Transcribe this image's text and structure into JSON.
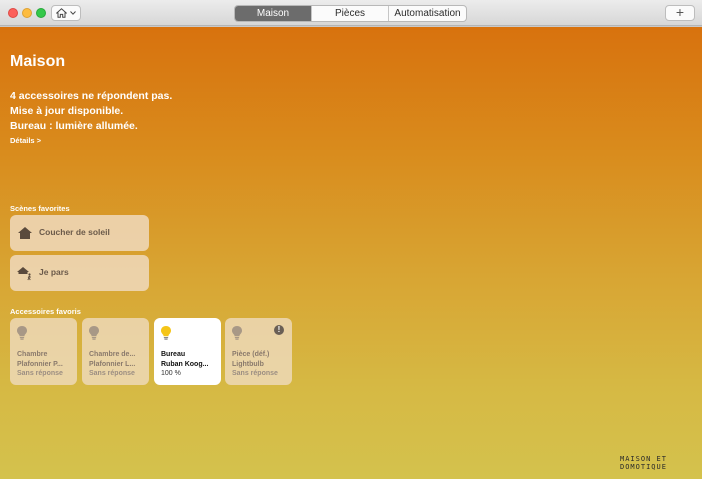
{
  "titlebar": {
    "tabs": [
      {
        "label": "Maison",
        "active": true
      },
      {
        "label": "Pièces",
        "active": false
      },
      {
        "label": "Automatisation",
        "active": false
      }
    ],
    "home_icon": "house-icon",
    "dropdown_icon": "chevron-down-icon",
    "add_label": "+"
  },
  "main": {
    "title": "Maison",
    "status": [
      "4 accessoires ne répondent pas.",
      "Mise à jour disponible.",
      "Bureau : lumière allumée."
    ],
    "details_link": "Détails >",
    "scenes_label": "Scènes favorites",
    "scenes": [
      {
        "label": "Coucher de soleil",
        "icon": "house-icon"
      },
      {
        "label": "Je pars",
        "icon": "house-walking-icon"
      }
    ],
    "accessories_label": "Accessoires favoris",
    "accessories": [
      {
        "name1": "Chambre",
        "name2": "Plafonnier P...",
        "status": "Sans réponse",
        "icon": "lightbulb-off-icon"
      },
      {
        "name1": "Chambre de...",
        "name2": "Plafonnier L...",
        "status": "Sans réponse",
        "icon": "lightbulb-off-icon"
      },
      {
        "name1": "Bureau",
        "name2": "Ruban Koog...",
        "status": "100 %",
        "icon": "lightbulb-on-icon"
      },
      {
        "name1": "Pièce (déf.)",
        "name2": "Lightbulb",
        "status": "Sans réponse",
        "icon": "lightbulb-off-icon",
        "warning": "!"
      }
    ]
  },
  "watermark": {
    "line1": "MAISON ET",
    "line2": "DOMOTIQUE"
  },
  "colors": {
    "accent_top": "#d8720e",
    "accent_bottom": "#d4c24d",
    "bulb_on": "#f5c518",
    "bulb_off": "#a89886"
  }
}
